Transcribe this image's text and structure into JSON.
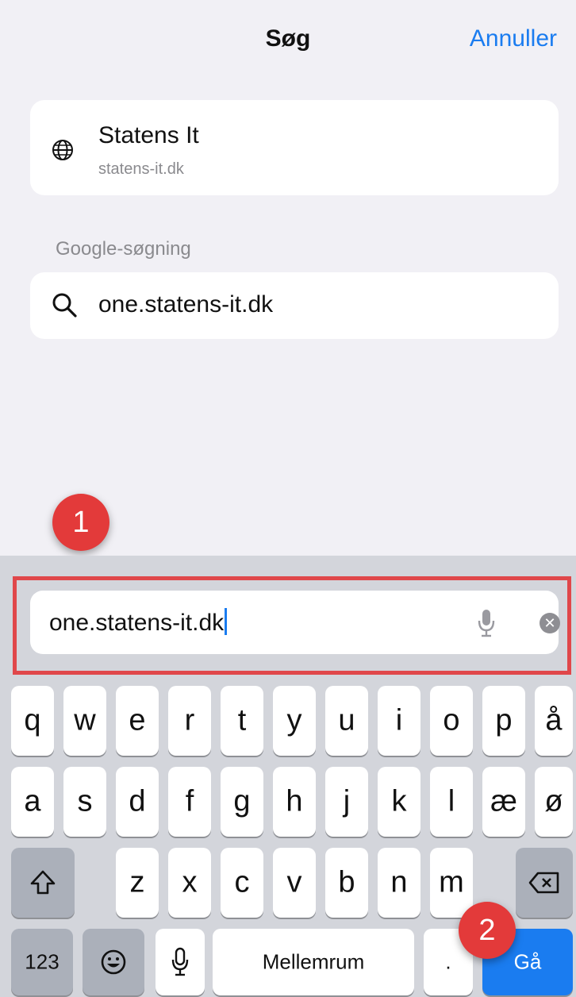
{
  "header": {
    "title": "Søg",
    "cancel_label": "Annuller"
  },
  "site_suggestion": {
    "icon": "globe-icon",
    "name": "Statens It",
    "url": "statens-it.dk"
  },
  "google_section": {
    "label": "Google-søgning",
    "query": "one.statens-it.dk"
  },
  "address_bar": {
    "value": "one.statens-it.dk"
  },
  "annotations": {
    "badge1": "1",
    "badge2": "2",
    "accent": "#e33a3a"
  },
  "keyboard": {
    "row1": [
      "q",
      "w",
      "e",
      "r",
      "t",
      "y",
      "u",
      "i",
      "o",
      "p",
      "å"
    ],
    "row2": [
      "a",
      "s",
      "d",
      "f",
      "g",
      "h",
      "j",
      "k",
      "l",
      "æ",
      "ø"
    ],
    "row3": [
      "z",
      "x",
      "c",
      "v",
      "b",
      "n",
      "m"
    ],
    "numbers_label": "123",
    "space_label": "Mellemrum",
    "period_label": ".",
    "go_label": "Gå",
    "go_color": "#1a7cf0"
  }
}
